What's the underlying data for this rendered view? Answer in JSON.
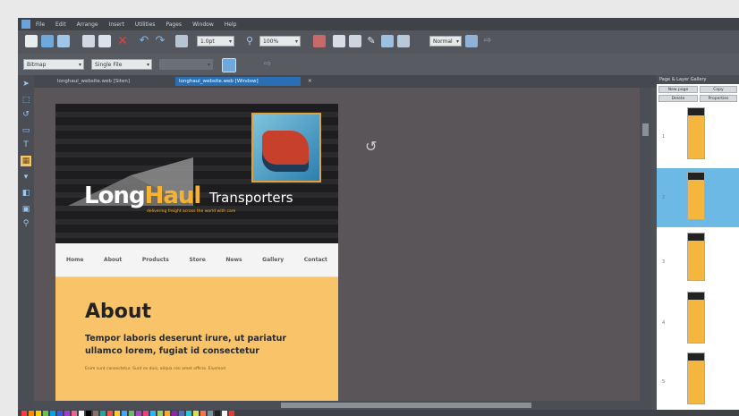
{
  "menu": [
    "File",
    "Edit",
    "Arrange",
    "Insert",
    "Utilities",
    "Pages",
    "Window",
    "Help"
  ],
  "toolbar": {
    "line_width": "1.0pt",
    "zoom": "100%",
    "view_mode": "Normal"
  },
  "infobar": {
    "left_combo": "Bitmap",
    "mid_combo": "Single File"
  },
  "tabs": [
    {
      "label": "longhaul_website.web [Siten]",
      "active": false
    },
    {
      "label": "longhaul_website.web [Window]",
      "active": true
    }
  ],
  "gallery": {
    "title": "Page & Layer Gallery",
    "buttons": [
      "New page",
      "Copy",
      "Delete",
      "Properties"
    ],
    "page_numbers": [
      "1",
      "2",
      "3",
      "4",
      "5"
    ]
  },
  "site": {
    "logo_long": "Long",
    "logo_haul": "Haul",
    "logo_suffix": "Transporters",
    "tagline": "delivering freight across the world with care",
    "nav": [
      "Home",
      "About",
      "Products",
      "Store",
      "News",
      "Gallery",
      "Contact"
    ],
    "about_heading": "About",
    "about_lead": "Tempor laboris deserunt irure, ut pariatur ullamco lorem, fugiat id consectetur",
    "about_small": "Enim sunt consectetur. Sunt ex duis, aliqua nisi amet officia. Eiusmod"
  },
  "colors": {
    "accent": "#f6b332",
    "tab_active": "#2a6fb3",
    "selected_page": "#6db9e6"
  },
  "palette": [
    "#ff3b3b",
    "#ff8a00",
    "#ffd000",
    "#6cc04a",
    "#00a4e4",
    "#3b5bdb",
    "#a23bd6",
    "#f06292",
    "#ffffff",
    "#000000",
    "#8d6e63",
    "#26a69a",
    "#ef5350",
    "#ffca28",
    "#42a5f5",
    "#66bb6a",
    "#ab47bc",
    "#ec407a",
    "#29b6f6",
    "#9ccc65",
    "#ffa726",
    "#8e24aa",
    "#5c6bc0",
    "#26c6da",
    "#d4e157",
    "#ff7043",
    "#78909c",
    "#212121",
    "#f5f5f5",
    "#e53935"
  ]
}
